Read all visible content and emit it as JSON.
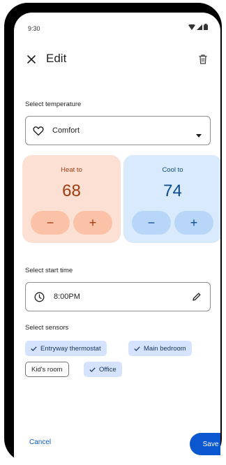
{
  "status_bar": {
    "time": "9:30"
  },
  "app_bar": {
    "title": "Edit"
  },
  "temperature": {
    "section_label": "Select temperature",
    "selected_preset": "Comfort",
    "heat": {
      "label": "Heat to",
      "value": "68"
    },
    "cool": {
      "label": "Cool to",
      "value": "74"
    },
    "minus_symbol": "−",
    "plus_symbol": "+"
  },
  "start_time": {
    "section_label": "Select start time",
    "value": "8:00PM"
  },
  "sensors": {
    "section_label": "Select sensors",
    "chips": [
      {
        "label": "Entryway thermostat",
        "selected": true
      },
      {
        "label": "Main bedroom",
        "selected": true
      },
      {
        "label": "Kid's room",
        "selected": false
      },
      {
        "label": "Office",
        "selected": true
      }
    ]
  },
  "footer": {
    "cancel_label": "Cancel",
    "save_label": "Save"
  },
  "colors": {
    "accent": "#0b57d0",
    "heat_bg": "#fde0d4",
    "heat_fg": "#a03a12",
    "cool_bg": "#d9eafc",
    "cool_fg": "#0b4b8c",
    "chip_selected": "#d6e3ff"
  },
  "icons": [
    "wifi-icon",
    "signal-icon",
    "battery-icon",
    "close-icon",
    "delete-icon",
    "heart-icon",
    "dropdown-arrow-icon",
    "clock-icon",
    "pencil-icon",
    "check-icon"
  ]
}
